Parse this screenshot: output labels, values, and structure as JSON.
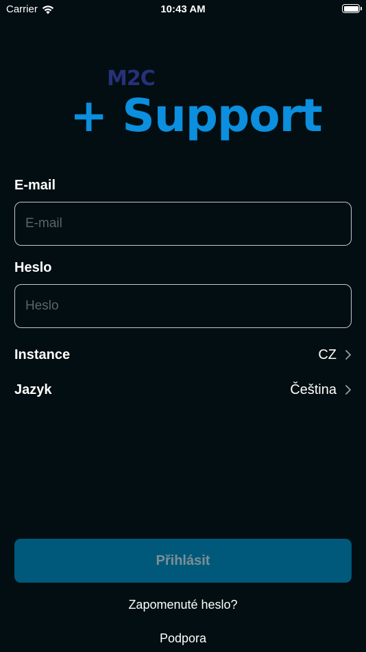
{
  "status_bar": {
    "carrier": "Carrier",
    "time": "10:43 AM",
    "wifi_icon": "wifi-icon",
    "battery_icon": "battery-icon",
    "battery_level": 1.0
  },
  "logo": {
    "brand": "M2C",
    "product": "+ Support",
    "brand_color": "#27317a",
    "product_color": "#0b8fde"
  },
  "form": {
    "email": {
      "label": "E-mail",
      "placeholder": "E-mail",
      "value": ""
    },
    "password": {
      "label": "Heslo",
      "placeholder": "Heslo",
      "value": ""
    },
    "instance": {
      "label": "Instance",
      "value": "CZ",
      "icon": "chevron-right-icon"
    },
    "language": {
      "label": "Jazyk",
      "value": "Čeština",
      "icon": "chevron-right-icon"
    }
  },
  "actions": {
    "login_label": "Přihlásit",
    "login_color": "#00597a",
    "forgot_password_label": "Zapomenuté heslo?",
    "support_label": "Podpora"
  },
  "colors": {
    "background": "#020e11",
    "accent": "#0b8fde"
  }
}
